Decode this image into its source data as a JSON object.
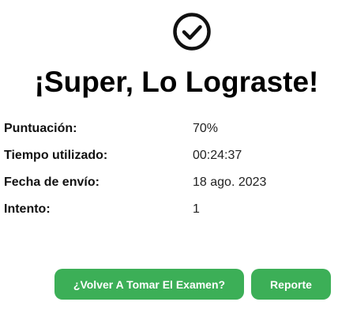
{
  "header": {
    "icon": "check-circle-icon",
    "title": "¡Super, Lo Lograste!"
  },
  "results": [
    {
      "label": "Puntuación:",
      "value": "70%"
    },
    {
      "label": "Tiempo utilizado:",
      "value": "00:24:37"
    },
    {
      "label": "Fecha de envío:",
      "value": "18 ago. 2023"
    },
    {
      "label": "Intento:",
      "value": "1"
    }
  ],
  "actions": {
    "retake_label": "¿Volver A Tomar El Examen?",
    "report_label": "Reporte"
  },
  "colors": {
    "accent": "#3caf57",
    "text": "#111111",
    "background": "#ffffff"
  }
}
